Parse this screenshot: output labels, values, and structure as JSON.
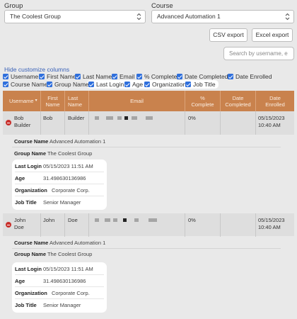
{
  "filters": {
    "group_label": "Group",
    "group_value": "The Coolest Group",
    "course_label": "Course",
    "course_value": "Advanced Automation 1"
  },
  "toolbar": {
    "csv_label": "CSV export",
    "excel_label": "Excel export",
    "search_placeholder": "Search by username, e"
  },
  "customize": {
    "toggle_label": "Hide customize columns",
    "columns": [
      {
        "label": "Username",
        "checked": true
      },
      {
        "label": "First Name",
        "checked": true
      },
      {
        "label": "Last Name",
        "checked": true
      },
      {
        "label": "Email",
        "checked": true
      },
      {
        "label": "% Complete",
        "checked": true
      },
      {
        "label": "Date Completed",
        "checked": true
      },
      {
        "label": "Date Enrolled",
        "checked": true
      },
      {
        "label": "Course Name",
        "checked": true
      },
      {
        "label": "Group Name",
        "checked": true
      },
      {
        "label": "Last Login",
        "checked": true
      },
      {
        "label": "Age",
        "checked": true
      },
      {
        "label": "Organization",
        "checked": true
      },
      {
        "label": "Job Title",
        "checked": true
      }
    ]
  },
  "table": {
    "headers": {
      "username": "Username",
      "first_name_1": "First",
      "first_name_2": "Name",
      "last_name_1": "Last",
      "last_name_2": "Name",
      "email": "Email",
      "complete_1": "%",
      "complete_2": "Complete",
      "completed_1": "Date",
      "completed_2": "Completed",
      "enrolled_1": "Date",
      "enrolled_2": "Enrolled"
    },
    "rows": [
      {
        "username_1": "Bob",
        "username_2": "Builder",
        "first_name": "Bob",
        "last_name": "Builder",
        "complete": "0%",
        "date_completed": "",
        "date_enrolled_1": "05/15/2023",
        "date_enrolled_2": "10:40 AM",
        "details": {
          "course_label": "Course Name",
          "course_value": "Advanced Automation 1",
          "group_label": "Group Name",
          "group_value": "The Coolest Group",
          "last_login_label": "Last Login",
          "last_login_value": "05/15/2023 11:51 AM",
          "age_label": "Age",
          "age_value": "31.498630136986",
          "org_label": "Organization",
          "org_value": "Corporate Corp.",
          "job_label": "Job Title",
          "job_value": "Senior Manager"
        }
      },
      {
        "username_1": "John",
        "username_2": "Doe",
        "first_name": "John",
        "last_name": "Doe",
        "complete": "0%",
        "date_completed": "",
        "date_enrolled_1": "05/15/2023",
        "date_enrolled_2": "10:40 AM",
        "details": {
          "course_label": "Course Name",
          "course_value": "Advanced Automation 1",
          "group_label": "Group Name",
          "group_value": "The Coolest Group",
          "last_login_label": "Last Login",
          "last_login_value": "05/15/2023 11:51 AM",
          "age_label": "Age",
          "age_value": "31.498630136986",
          "org_label": "Organization",
          "org_value": "Corporate Corp.",
          "job_label": "Job Title",
          "job_value": "Senior Manager"
        }
      }
    ]
  },
  "colors": {
    "header_bg": "#c9824d",
    "checkbox": "#2f6fdc",
    "link": "#3a62b8",
    "remove_icon": "#c9302c"
  },
  "icons": [
    "chevron-updown-icon",
    "checkbox-checked-icon",
    "remove-row-icon",
    "sort-arrow-icon"
  ]
}
